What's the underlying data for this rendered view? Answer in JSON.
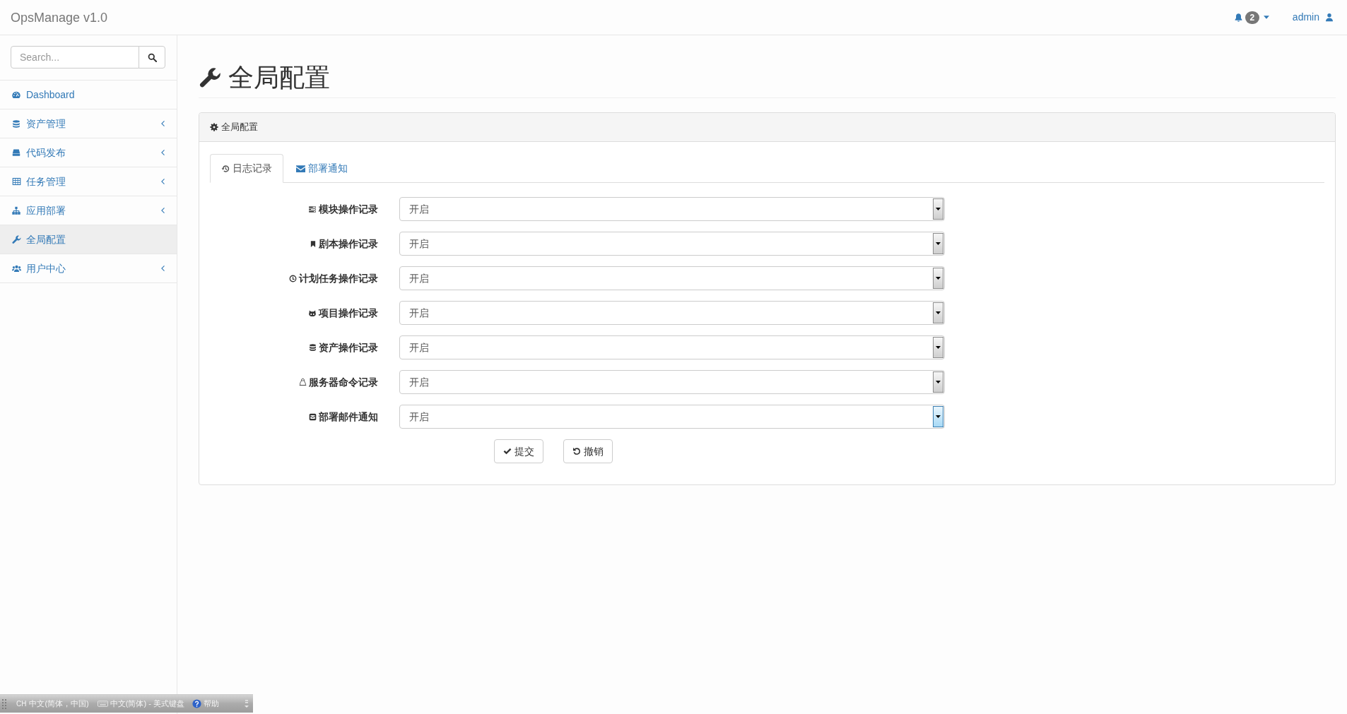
{
  "navbar": {
    "brand": "OpsManage v1.0",
    "notification_count": "2",
    "user": "admin"
  },
  "sidebar": {
    "search": {
      "placeholder": "Search..."
    },
    "items": [
      {
        "label": "Dashboard",
        "selected": false,
        "has_submenu": false
      },
      {
        "label": "资产管理",
        "selected": false,
        "has_submenu": true
      },
      {
        "label": "代码发布",
        "selected": false,
        "has_submenu": true
      },
      {
        "label": "任务管理",
        "selected": false,
        "has_submenu": true
      },
      {
        "label": "应用部署",
        "selected": false,
        "has_submenu": true
      },
      {
        "label": "全局配置",
        "selected": true,
        "has_submenu": false
      },
      {
        "label": "用户中心",
        "selected": false,
        "has_submenu": true
      }
    ]
  },
  "page": {
    "title": "全局配置"
  },
  "panel": {
    "heading": "全局配置",
    "tabs": [
      {
        "label": "日志记录",
        "selected": true
      },
      {
        "label": "部署通知",
        "selected": false
      }
    ],
    "fields": [
      {
        "label": "模块操作记录",
        "value": "开启",
        "focused": false
      },
      {
        "label": "剧本操作记录",
        "value": "开启",
        "focused": false
      },
      {
        "label": "计划任务操作记录",
        "value": "开启",
        "focused": false
      },
      {
        "label": "项目操作记录",
        "value": "开启",
        "focused": false
      },
      {
        "label": "资产操作记录",
        "value": "开启",
        "focused": false
      },
      {
        "label": "服务器命令记录",
        "value": "开启",
        "focused": false
      },
      {
        "label": "部署邮件通知",
        "value": "开启",
        "focused": true
      }
    ],
    "buttons": [
      {
        "label": "提交"
      },
      {
        "label": "撤销"
      }
    ]
  },
  "language_bar": {
    "code": "CH",
    "input_language": "中文(简体，中国)",
    "keyboard_layout": "中文(简体) - 美式键盘",
    "help": "帮助"
  }
}
